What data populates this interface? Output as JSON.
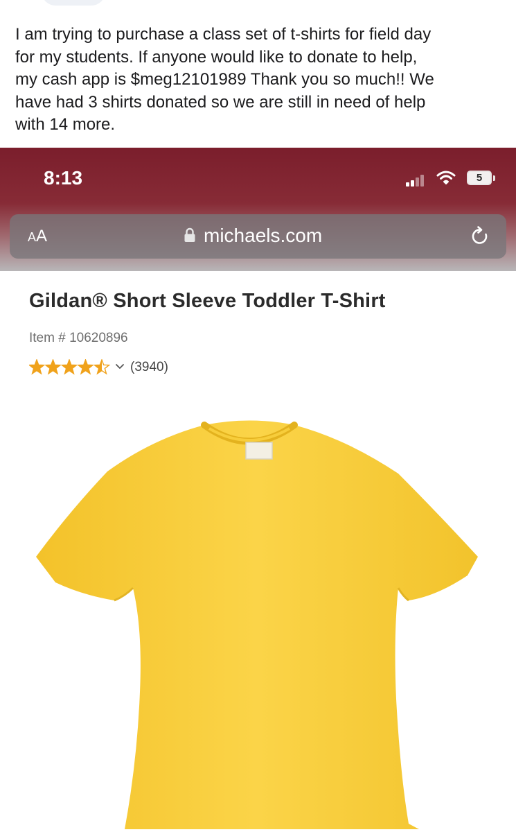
{
  "post": {
    "text": "I am trying to purchase a class set of t-shirts for field day\nfor my students. If anyone would like to donate to help,\nmy cash app is $meg12101989 Thank you so much!! We\nhave had 3 shirts donated so we are still in need of help\nwith 14 more."
  },
  "status_bar": {
    "time": "8:13",
    "battery": "5",
    "icons": [
      "signal-icon",
      "wifi-icon",
      "battery-icon"
    ]
  },
  "browser": {
    "aa_big": "A",
    "aa_small": "A",
    "url": "michaels.com",
    "icons": [
      "lock-icon",
      "reload-icon"
    ]
  },
  "product": {
    "title": "Gildan® Short Sleeve Toddler T-Shirt",
    "item_number": "Item # 10620896",
    "rating": 4.5,
    "rating_max": 5,
    "review_count": "(3940)",
    "shirt_color": "#f8cf3a"
  },
  "colors": {
    "chrome_top": "#7b1e2c",
    "star": "#f0a21b",
    "title_text": "#2b2b2b"
  }
}
